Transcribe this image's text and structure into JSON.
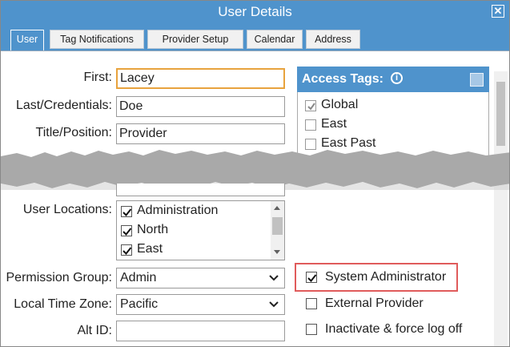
{
  "window": {
    "title": "User Details"
  },
  "tabs": [
    {
      "label": "User",
      "active": true
    },
    {
      "label": "Tag Notifications"
    },
    {
      "label": "Provider Setup"
    },
    {
      "label": "Calendar"
    },
    {
      "label": "Address"
    }
  ],
  "form": {
    "first": {
      "label": "First:",
      "value": "Lacey"
    },
    "last": {
      "label": "Last/Credentials:",
      "value": "Doe"
    },
    "title": {
      "label": "Title/Position:",
      "value": "Provider"
    },
    "locations": {
      "label": "User Locations:",
      "items": [
        "Administration",
        "North",
        "East"
      ]
    },
    "permission_group": {
      "label": "Permission Group:",
      "value": "Admin"
    },
    "time_zone": {
      "label": "Local Time Zone:",
      "value": "Pacific"
    },
    "alt_id": {
      "label": "Alt ID:",
      "value": ""
    }
  },
  "access_tags": {
    "title": "Access Tags:",
    "items": [
      "Global",
      "East",
      "East Past"
    ]
  },
  "options": {
    "system_admin": "System Administrator",
    "external_provider": "External Provider",
    "inactivate": "Inactivate & force log off"
  },
  "colors": {
    "accent": "#4f93cc",
    "focus": "#e8a33d",
    "highlight": "#e05b5b"
  }
}
